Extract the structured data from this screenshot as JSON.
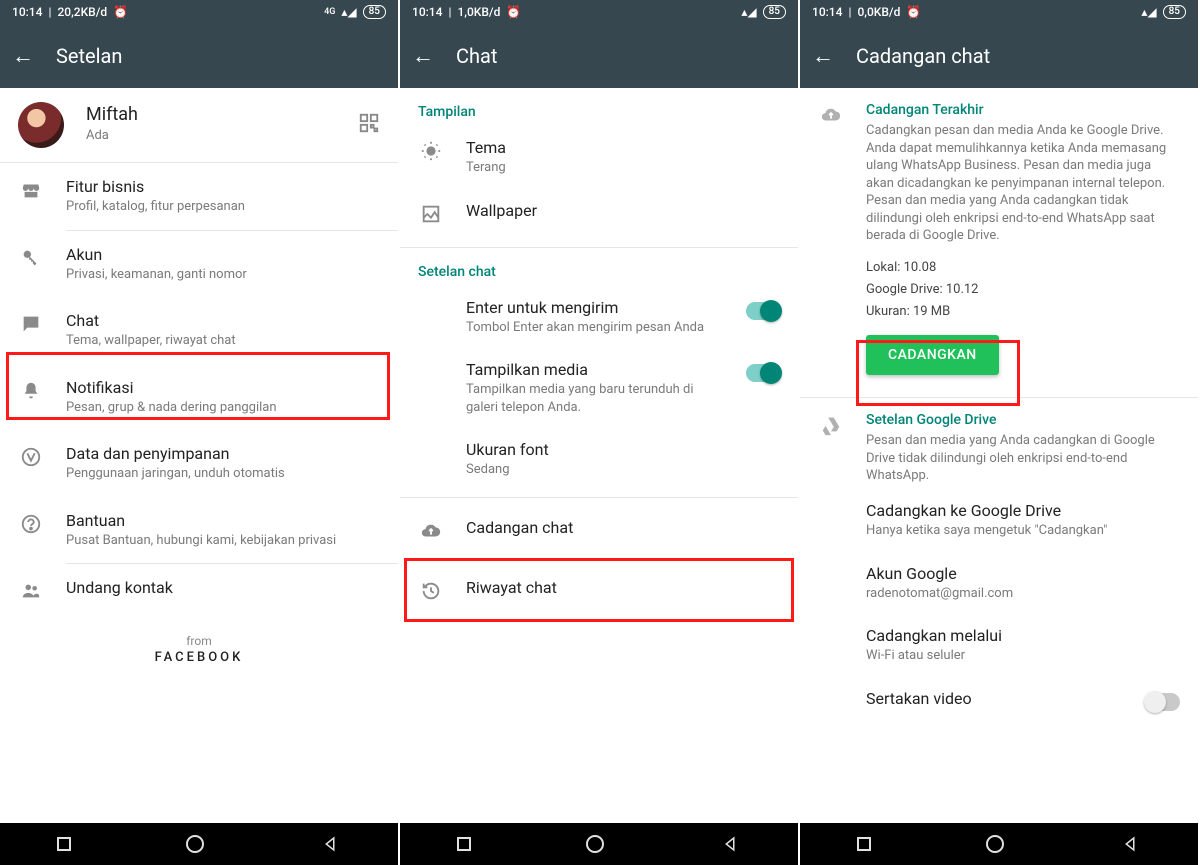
{
  "screens": [
    {
      "status": {
        "time": "10:14",
        "rate": "20,2KB/d",
        "battery": "85"
      },
      "title": "Setelan",
      "profile": {
        "name": "Miftah",
        "status": "Ada"
      },
      "items": [
        {
          "title": "Fitur bisnis",
          "sub": "Profil, katalog, fitur perpesanan"
        },
        {
          "title": "Akun",
          "sub": "Privasi, keamanan, ganti nomor"
        },
        {
          "title": "Chat",
          "sub": "Tema, wallpaper, riwayat chat"
        },
        {
          "title": "Notifikasi",
          "sub": "Pesan, grup & nada dering panggilan"
        },
        {
          "title": "Data dan penyimpanan",
          "sub": "Penggunaan jaringan, unduh otomatis"
        },
        {
          "title": "Bantuan",
          "sub": "Pusat Bantuan, hubungi kami, kebijakan privasi"
        },
        {
          "title": "Undang kontak",
          "sub": ""
        }
      ],
      "from": "from",
      "brand": "FACEBOOK"
    },
    {
      "status": {
        "time": "10:14",
        "rate": "1,0KB/d",
        "battery": "85"
      },
      "title": "Chat",
      "section1": "Tampilan",
      "tema": {
        "title": "Tema",
        "sub": "Terang"
      },
      "wallpaper": "Wallpaper",
      "section2": "Setelan chat",
      "enter": {
        "title": "Enter untuk mengirim",
        "sub": "Tombol Enter akan mengirim pesan Anda"
      },
      "media": {
        "title": "Tampilkan media",
        "sub": "Tampilkan media yang baru terunduh di galeri telepon Anda."
      },
      "font": {
        "title": "Ukuran font",
        "sub": "Sedang"
      },
      "backup": "Cadangan chat",
      "history": "Riwayat chat"
    },
    {
      "status": {
        "time": "10:14",
        "rate": "0,0KB/d",
        "battery": "85"
      },
      "title": "Cadangan chat",
      "last_hdr": "Cadangan Terakhir",
      "last_desc": "Cadangkan pesan dan media Anda ke Google Drive. Anda dapat memulihkannya ketika Anda memasang ulang WhatsApp Business. Pesan dan media juga akan dicadangkan ke penyimpanan internal telepon. Pesan dan media yang Anda cadangkan tidak dilindungi oleh enkripsi end-to-end WhatsApp saat berada di Google Drive.",
      "local": "Lokal: 10.08",
      "gdrive": "Google Drive: 10.12",
      "size": "Ukuran: 19 MB",
      "btn": "CADANGKAN",
      "gd_hdr": "Setelan Google Drive",
      "gd_desc": "Pesan dan media yang Anda cadangkan di Google Drive tidak dilindungi oleh enkripsi end-to-end WhatsApp.",
      "to_drive": {
        "title": "Cadangkan ke Google Drive",
        "sub": "Hanya ketika saya mengetuk \"Cadangkan\""
      },
      "account": {
        "title": "Akun Google",
        "sub": "radenotomat@gmail.com"
      },
      "via": {
        "title": "Cadangkan melalui",
        "sub": "Wi-Fi atau seluler"
      },
      "video": "Sertakan video"
    }
  ]
}
